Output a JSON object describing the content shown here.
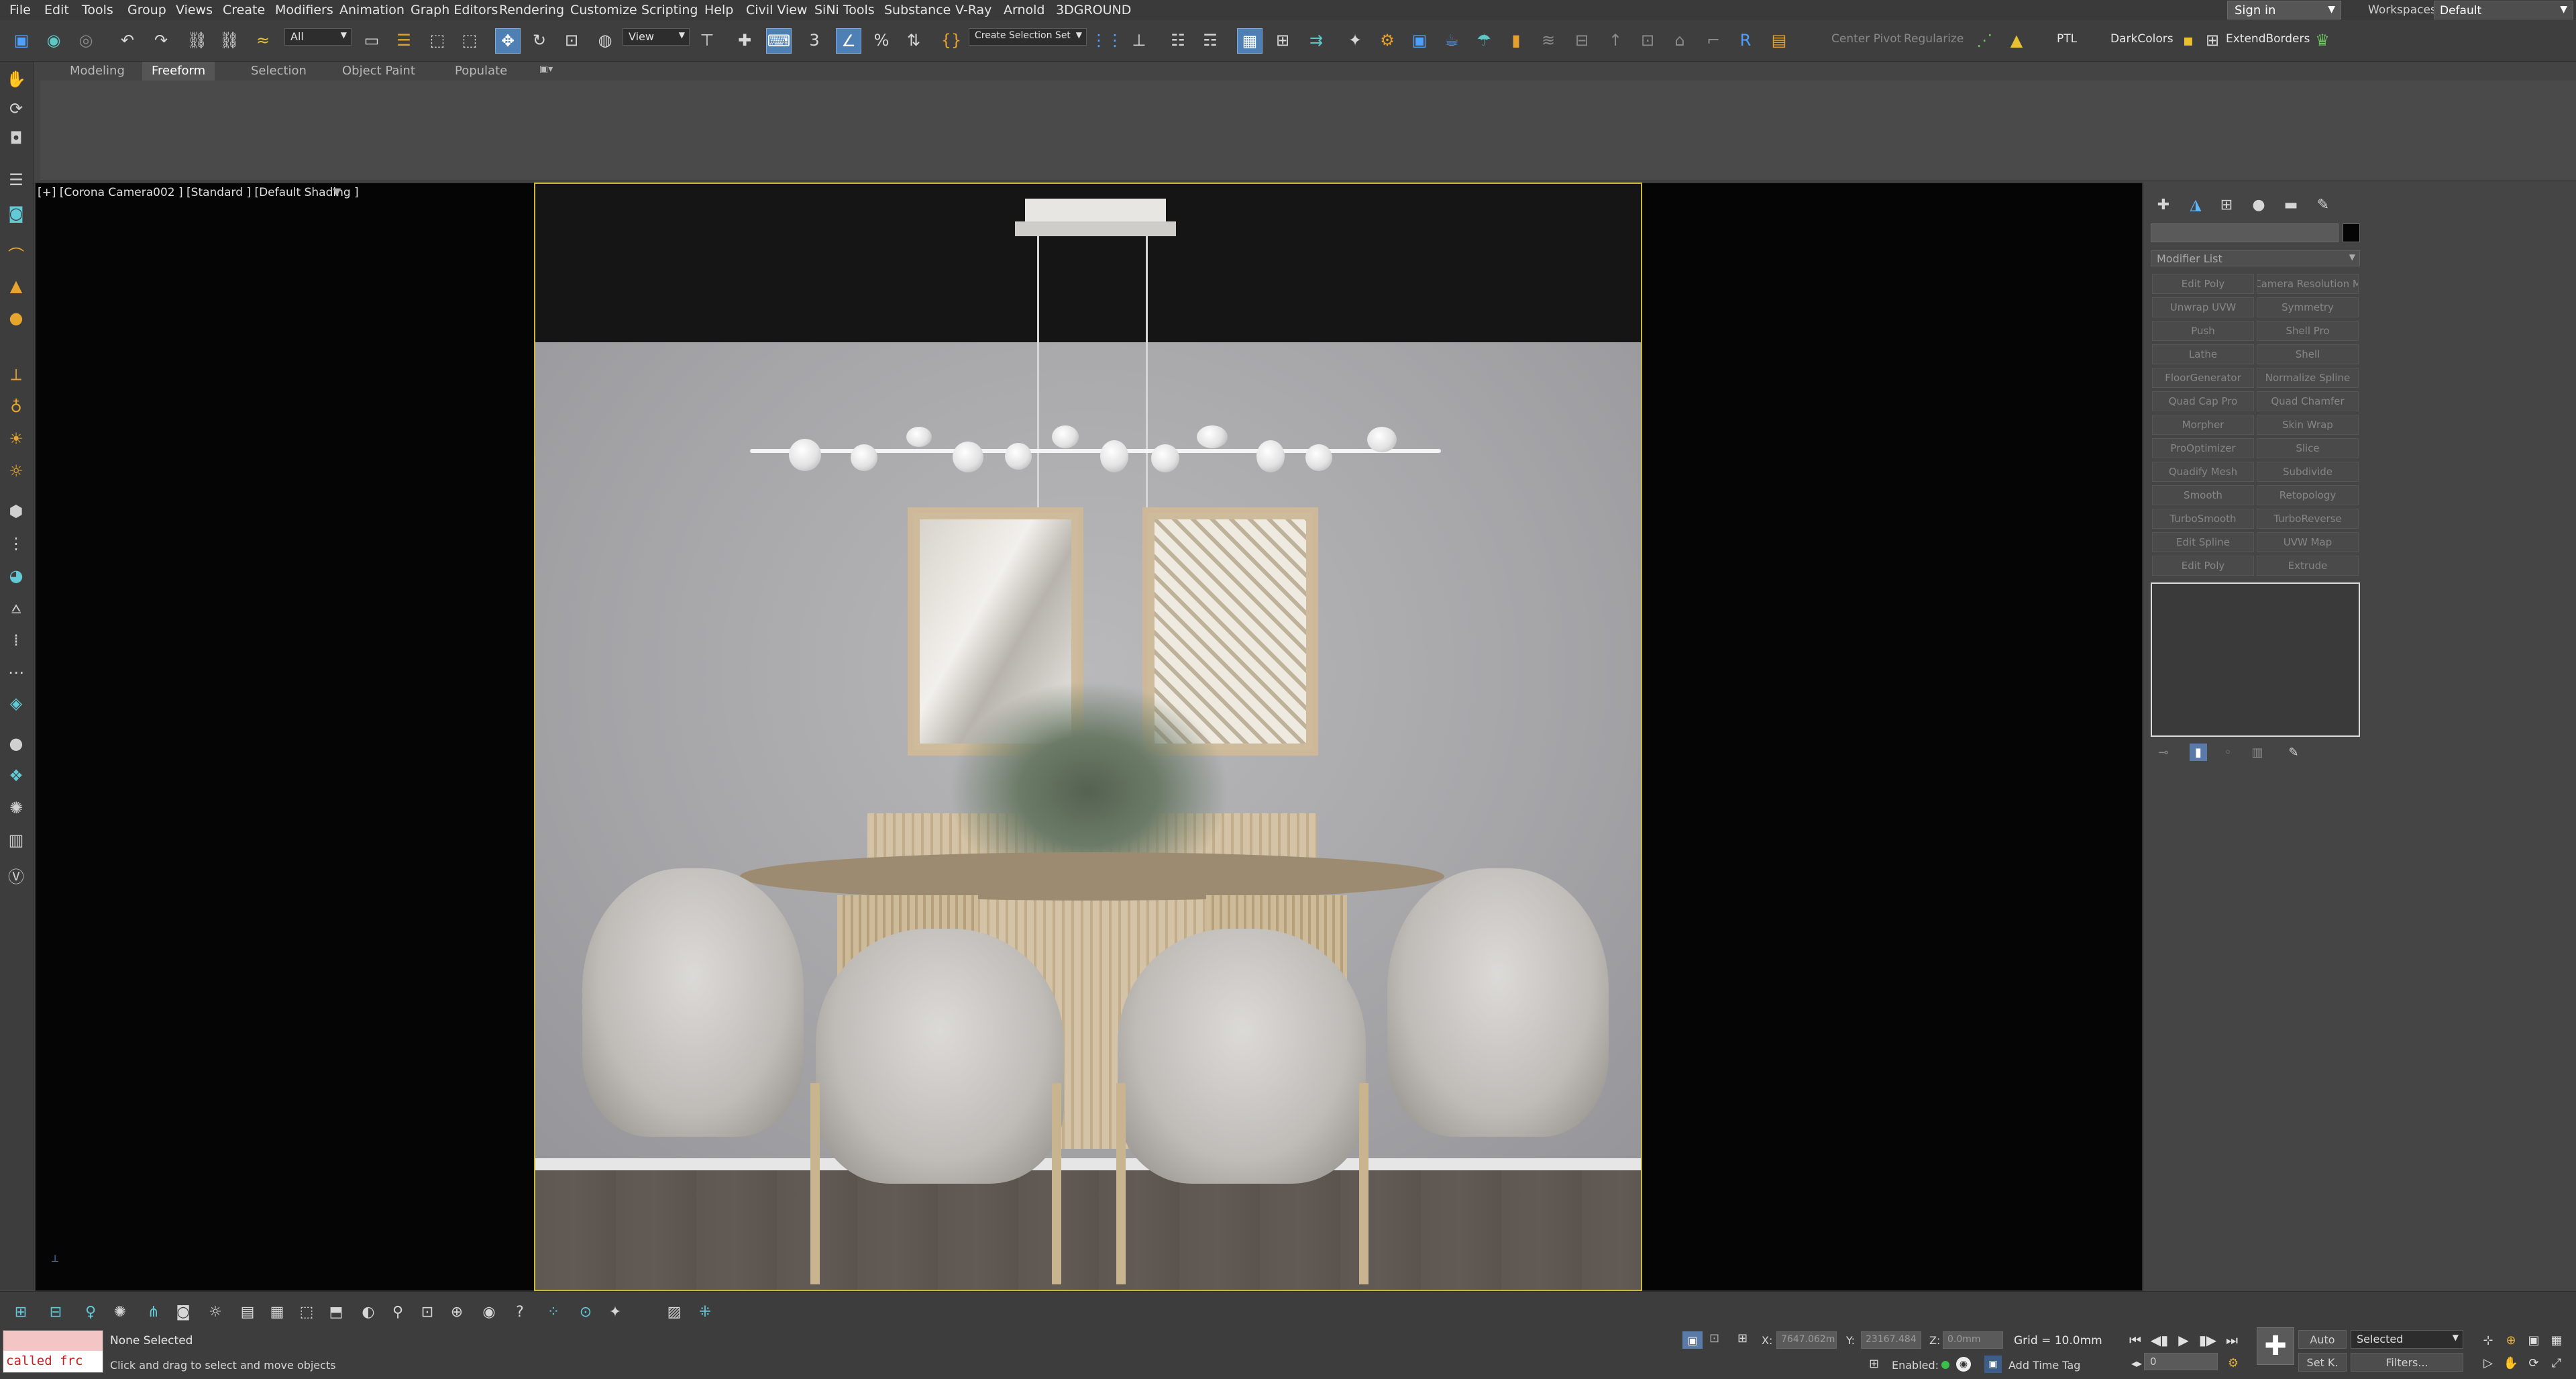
{
  "menu": [
    "File",
    "Edit",
    "Tools",
    "Group",
    "Views",
    "Create",
    "Modifiers",
    "Animation",
    "Graph Editors",
    "Rendering",
    "Customize",
    "Scripting",
    "Help",
    "Civil View",
    "SiNi Tools",
    "Substance",
    "V-Ray",
    "Arnold",
    "3DGROUND"
  ],
  "account": {
    "sign_in": "Sign in",
    "workspaces_label": "Workspaces:",
    "workspace": "Default"
  },
  "toolbar": {
    "selection_filter": "All",
    "ref_coord": "View",
    "named_selection": "Create Selection Set",
    "center_pivot": "Center Pivot",
    "regularize": "Regularize",
    "ptl": "PTL",
    "dark_colors": "DarkColors",
    "extend_borders": "ExtendBorders",
    "snap_label": "3",
    "percent_snap": "%"
  },
  "ribbon": {
    "tabs": [
      "Modeling",
      "Freeform",
      "Selection",
      "Object Paint",
      "Populate"
    ],
    "active": "Freeform"
  },
  "viewport": {
    "label": "[+] [Corona Camera002 ] [Standard ] [Default Shading ]"
  },
  "command_panel": {
    "modifier_list": "Modifier List",
    "modifiers": [
      [
        "Edit Poly",
        "Camera Resolution M"
      ],
      [
        "Unwrap UVW",
        "Symmetry"
      ],
      [
        "Push",
        "Shell Pro"
      ],
      [
        "Lathe",
        "Shell"
      ],
      [
        "FloorGenerator",
        "Normalize Spline"
      ],
      [
        "Quad Cap Pro",
        "Quad Chamfer"
      ],
      [
        "Morpher",
        "Skin Wrap"
      ],
      [
        "ProOptimizer",
        "Slice"
      ],
      [
        "Quadify Mesh",
        "Subdivide"
      ],
      [
        "Smooth",
        "Retopology"
      ],
      [
        "TurboSmooth",
        "TurboReverse"
      ],
      [
        "Edit Spline",
        "UVW Map"
      ],
      [
        "Edit Poly",
        "Extrude"
      ]
    ]
  },
  "status": {
    "maxscript_error": "called frc",
    "selection": "None Selected",
    "prompt": "Click and drag to select and move objects",
    "x_label": "X:",
    "x_value": "7647.062m",
    "y_label": "Y:",
    "y_value": "23167.484",
    "z_label": "Z:",
    "z_value": "0.0mm",
    "grid": "Grid = 10.0mm",
    "enabled": "Enabled:",
    "add_time_tag": "Add Time Tag",
    "auto": "Auto",
    "set_k": "Set K.",
    "key_filter": "Selected",
    "filters": "Filters...",
    "frame": "0"
  },
  "colors": {
    "viewport_border": "#c8b83a",
    "active_tool": "#4e7fb5",
    "error_text": "#c02020"
  }
}
